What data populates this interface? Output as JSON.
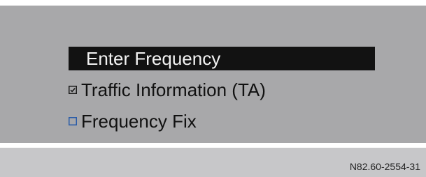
{
  "menu": {
    "items": [
      {
        "label": "Enter Frequency",
        "selected": true
      },
      {
        "label": "Traffic Information (TA)",
        "checked": true,
        "icon": "checkbox-checked-icon"
      },
      {
        "label": "Frequency Fix",
        "checked": false,
        "icon": "checkbox-unchecked-icon"
      }
    ]
  },
  "footer": {
    "reference_code": "N82.60-2554-31"
  },
  "colors": {
    "screen_background": "#a8a8aa",
    "selection_background": "#121212",
    "selection_text": "#f2f2f2",
    "text": "#111111",
    "checkbox_accent": "#2a5ca8",
    "footer_background": "#c7c7c9"
  }
}
